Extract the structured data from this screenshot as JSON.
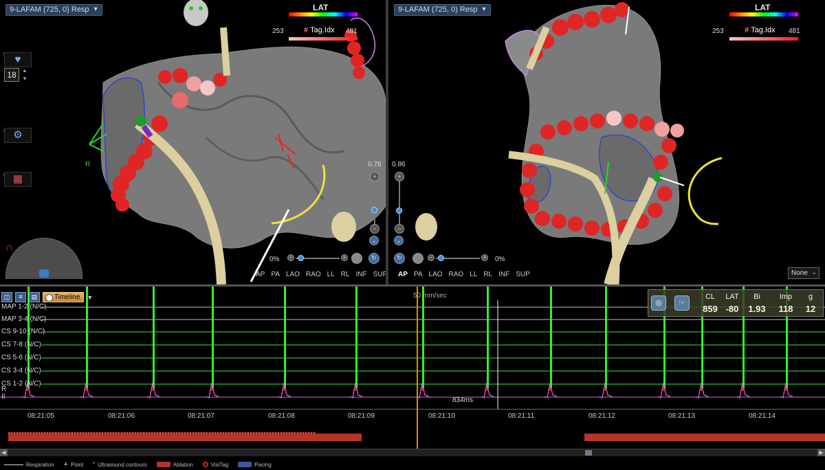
{
  "left_view": {
    "map_name": "9-LAFAM (725, 0) Resp",
    "scale_title": "LAT",
    "tag_min": "253",
    "tag_label": "Tag.Idx",
    "tag_max": "481",
    "frame_count": "18",
    "zoom_value": "0.78",
    "opacity_pct": "0%",
    "orientation_marker": "R",
    "views": [
      "AP",
      "PA",
      "LAO",
      "RAO",
      "LL",
      "RL",
      "INF",
      "SUP"
    ]
  },
  "right_view": {
    "map_name": "9-LAFAM (725, 0) Resp",
    "scale_title": "LAT",
    "tag_min": "253",
    "tag_label": "Tag.Idx",
    "tag_max": "481",
    "zoom_value": "0.86",
    "opacity_pct": "0%",
    "views": [
      "AP",
      "PA",
      "LAO",
      "RAO",
      "LL",
      "RL",
      "INF",
      "SUP"
    ],
    "active_view": "AP",
    "dropdown_value": "None"
  },
  "ecg": {
    "timeline_label": "Timeline",
    "speed": "50 mm/sec",
    "interval_label": "834ms",
    "channels": [
      "MAP 1-2 (N/C)",
      "MAP 3-4 (N/C)",
      "CS 9-10 (N/C)",
      "CS 7-8 (N/C)",
      "CS 5-6 (N/C)",
      "CS 3-4 (N/C)",
      "CS 1-2 (N/C)",
      "II"
    ],
    "lead_marker": "R",
    "time_ticks": [
      "08:21:05",
      "08:21:06",
      "08:21:07",
      "08:21:08",
      "08:21:09",
      "08:21:10",
      "08:21:11",
      "08:21:12",
      "08:21:13",
      "08:21:14"
    ],
    "readout": {
      "headers": [
        "CL",
        "LAT",
        "Bi",
        "Imp",
        "g"
      ],
      "values": [
        "859",
        "-80",
        "1.93",
        "118",
        "12"
      ]
    }
  },
  "legend": {
    "respiration": "Respiration",
    "point": "Point",
    "ultrasound": "Ultrasound contours",
    "ablation": "Ablation",
    "visitag": "VisiTag",
    "pacing": "Pacing"
  },
  "colors": {
    "ecg_green": "#33ee33",
    "map_white": "#ffffff",
    "lead_ii": "#dd66dd",
    "ablation_bar": "#b5352a",
    "tag_red": "#e02525",
    "catheter": "#dccfa0",
    "surface": "#7c7c7c"
  }
}
